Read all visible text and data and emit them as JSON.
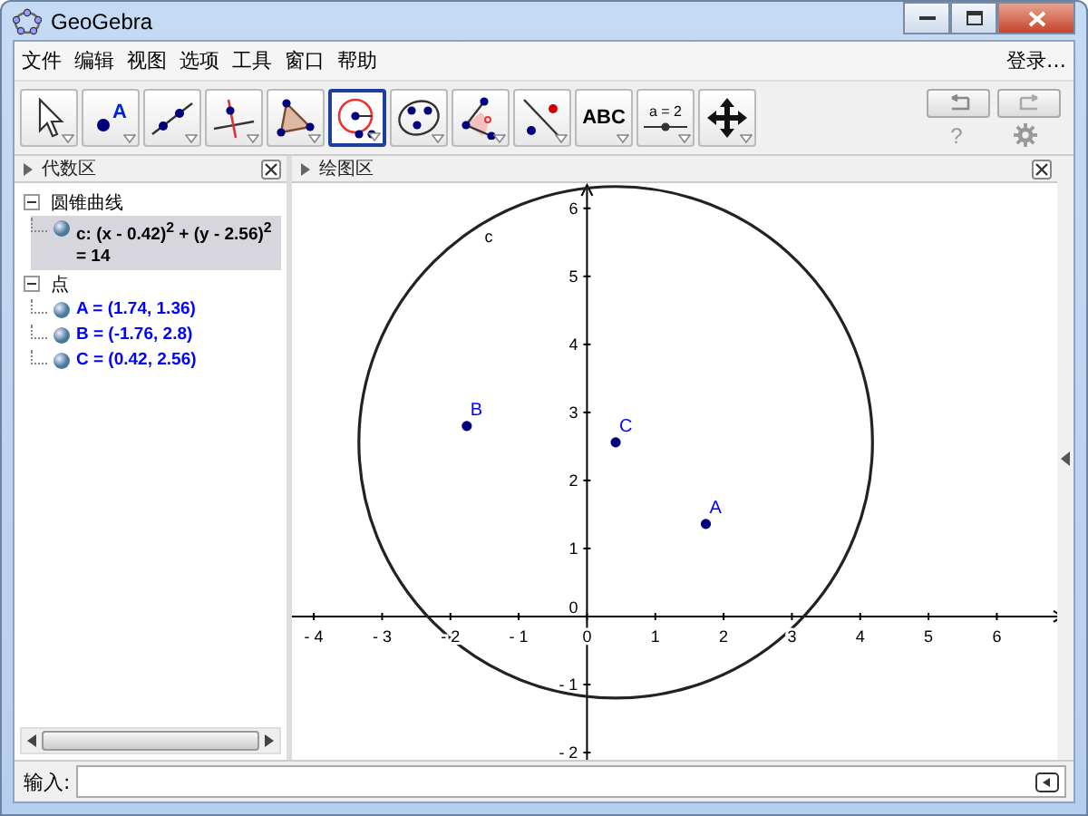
{
  "window": {
    "title": "GeoGebra"
  },
  "menu": {
    "items": [
      "文件",
      "编辑",
      "视图",
      "选项",
      "工具",
      "窗口",
      "帮助"
    ],
    "login": "登录…"
  },
  "toolbar": {
    "tools": [
      {
        "kind": "move",
        "selected": false
      },
      {
        "kind": "point",
        "selected": false,
        "label": "A"
      },
      {
        "kind": "line",
        "selected": false
      },
      {
        "kind": "perpendicular",
        "selected": false
      },
      {
        "kind": "polygon",
        "selected": false
      },
      {
        "kind": "circle",
        "selected": true
      },
      {
        "kind": "conic",
        "selected": false
      },
      {
        "kind": "angle",
        "selected": false
      },
      {
        "kind": "reflect",
        "selected": false
      },
      {
        "kind": "text",
        "selected": false,
        "label": "ABC"
      },
      {
        "kind": "slider",
        "selected": false,
        "label": "a = 2"
      },
      {
        "kind": "pan",
        "selected": false
      }
    ],
    "help": "?"
  },
  "algebra": {
    "title": "代数区",
    "groups": [
      {
        "label": "圆锥曲线",
        "expanded": true,
        "children": [
          {
            "text": "c: (x - 0.42)$^{2}$ + (y - 2.56)$^{2}$ = 14",
            "selected": true,
            "color": "#000000"
          }
        ]
      },
      {
        "label": "点",
        "expanded": true,
        "children": [
          {
            "text": "A = (1.74, 1.36)",
            "selected": false,
            "color": "#0000ff"
          },
          {
            "text": "B = (-1.76, 2.8)",
            "selected": false,
            "color": "#0000ff"
          },
          {
            "text": "C = (0.42, 2.56)",
            "selected": false,
            "color": "#0000ff"
          }
        ]
      }
    ]
  },
  "graphics": {
    "title": "绘图区",
    "chart_data": {
      "type": "scatter",
      "xlim": [
        -4.32,
        6.99
      ],
      "ylim": [
        -2.24,
        6.37
      ],
      "xticks": [
        {
          "value": -4,
          "label": "- 4"
        },
        {
          "value": -3,
          "label": "- 3"
        },
        {
          "value": -2,
          "label": "- 2"
        },
        {
          "value": -1,
          "label": "- 1"
        },
        {
          "value": 0,
          "label": "0"
        },
        {
          "value": 1,
          "label": "1"
        },
        {
          "value": 2,
          "label": "2"
        },
        {
          "value": 3,
          "label": "3"
        },
        {
          "value": 4,
          "label": "4"
        },
        {
          "value": 5,
          "label": "5"
        },
        {
          "value": 6,
          "label": "6"
        }
      ],
      "yticks": [
        {
          "value": -2,
          "label": "- 2"
        },
        {
          "value": -1,
          "label": "- 1"
        },
        {
          "value": 0,
          "label": "0"
        },
        {
          "value": 1,
          "label": "1"
        },
        {
          "value": 2,
          "label": "2"
        },
        {
          "value": 3,
          "label": "3"
        },
        {
          "value": 4,
          "label": "4"
        },
        {
          "value": 5,
          "label": "5"
        },
        {
          "value": 6,
          "label": "6"
        }
      ],
      "x": [
        1.74,
        -1.76,
        0.42
      ],
      "series": [
        {
          "color": "#00007f",
          "values": [
            1.36,
            2.8,
            2.56
          ]
        }
      ],
      "annotations": [
        {
          "text": "A",
          "x": 1.74,
          "y": 1.36
        },
        {
          "text": "B",
          "x": -1.76,
          "y": 2.8
        },
        {
          "text": "C",
          "x": 0.42,
          "y": 2.56
        }
      ]
    },
    "circle_label": "c"
  },
  "input": {
    "label": "输入:"
  }
}
